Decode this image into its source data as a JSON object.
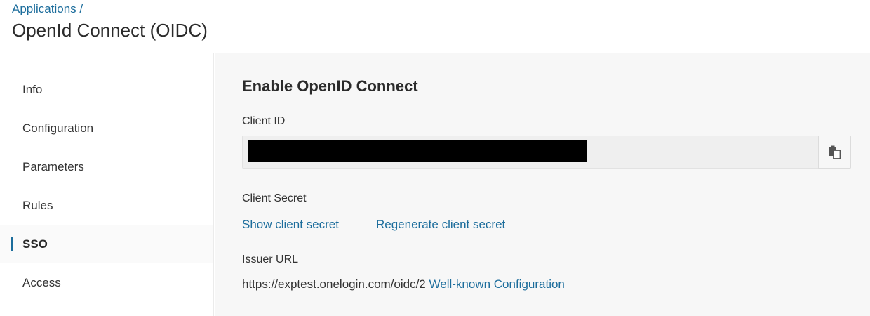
{
  "header": {
    "breadcrumb": "Applications /",
    "title": "OpenId Connect (OIDC)"
  },
  "sidebar": {
    "items": [
      {
        "label": "Info"
      },
      {
        "label": "Configuration"
      },
      {
        "label": "Parameters"
      },
      {
        "label": "Rules"
      },
      {
        "label": "SSO",
        "active": true
      },
      {
        "label": "Access"
      }
    ]
  },
  "main": {
    "section_title": "Enable OpenID Connect",
    "client_id": {
      "label": "Client ID",
      "value": "",
      "copy_icon": "clipboard-icon"
    },
    "client_secret": {
      "label": "Client Secret",
      "show_link": "Show client secret",
      "regenerate_link": "Regenerate client secret"
    },
    "issuer": {
      "label": "Issuer URL",
      "url": "https://exptest.onelogin.com/oidc/2",
      "well_known_link": "Well-known Configuration"
    }
  },
  "colors": {
    "accent": "#1c6d9c",
    "main_background": "#f7f7f7",
    "redaction": "#000000"
  }
}
